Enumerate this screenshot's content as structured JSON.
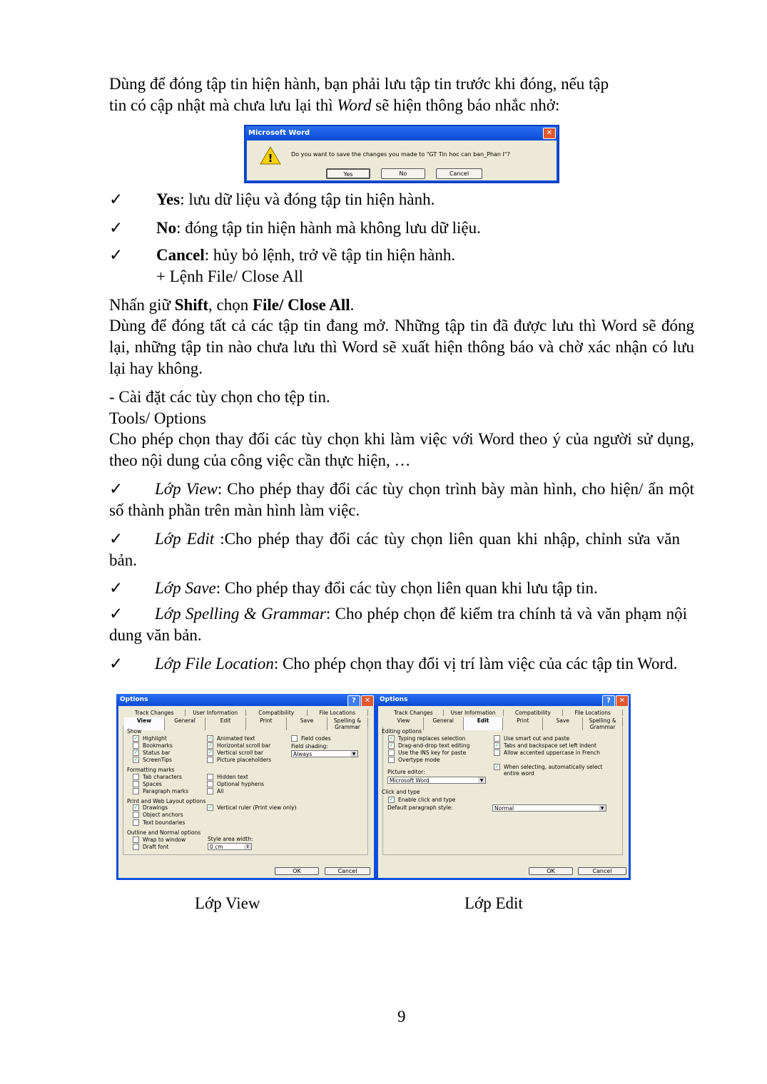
{
  "intro": {
    "line1": "Dùng để đóng tập tin hiện hành, bạn phải lưu tập tin trước khi đóng, nếu tập",
    "line2a": "tin có cập nhật mà chưa lưu lại thì ",
    "line2b": "Word",
    "line2c": " sẽ hiện thông báo nhắc nhở:"
  },
  "msgbox": {
    "title": "Microsoft Word",
    "icon": "warning-icon",
    "message": "Do you want to save the changes you made to \"GT Tin hoc can ban_Phan I\"?",
    "yes": "Yes",
    "no": "No",
    "cancel": "Cancel"
  },
  "check_glyph": "✓",
  "bullets": [
    {
      "bold": "Yes",
      "text": ": lưu dữ liệu và đóng tập tin hiện hành."
    },
    {
      "bold": "No",
      "text": ": đóng tập tin hiện hành mà không lưu dữ liệu."
    },
    {
      "bold": "Cancel",
      "text": ": hủy bỏ lệnh, trở về tập tin hiện hành."
    }
  ],
  "close_all": {
    "heading": "+ Lệnh File/ Close All",
    "p1a": "Nhấn giữ ",
    "p1b": "Shift",
    "p1c": ", chọn ",
    "p1d": "File/ Close All",
    "p1e": ".",
    "p2": "Dùng để đóng tất cả các tập tin đang mở. Những tập tin đã được lưu thì Word sẽ đóng lại, những tập tin nào chưa lưu thì Word sẽ xuất hiện thông báo và chờ xác nhận có lưu lại hay không."
  },
  "options": {
    "heading": "- Cài đặt các tùy chọn cho tệp tin.",
    "menu": "Tools/ Options",
    "desc": "Cho phép chọn thay đổi các tùy chọn khi làm việc với Word theo ý của người sử dụng, theo nội dung của công việc cần thực hiện, …"
  },
  "tabs_list": [
    {
      "name": "Lớp View",
      "text": ": Cho phép thay đổi các tùy chọn trình bày màn hình, cho hiện/ ẩn một số thành phần trên màn hình làm việc."
    },
    {
      "name": "Lớp Edit",
      "text": " :Cho phép thay đổi các tùy chọn liên quan khi nhập, chỉnh sửa văn bản."
    },
    {
      "name": "Lớp Save",
      "text": ": Cho phép thay đổi các tùy chọn liên quan khi lưu tập tin."
    },
    {
      "name": "Lớp Spelling & Grammar",
      "text": ": Cho phép chọn để kiểm tra chính tả và văn phạm nội dung văn bản."
    },
    {
      "name": "Lớp File Location",
      "text": ": Cho phép chọn thay đổi vị trí làm việc của các tập tin Word."
    }
  ],
  "dialog_common": {
    "tabs_row1": [
      "Track Changes",
      "User Information",
      "Compatibility",
      "File Locations"
    ],
    "tabs_row2": [
      "View",
      "General",
      "Edit",
      "Print",
      "Save",
      "Spelling & Grammar"
    ],
    "ok": "OK",
    "cancel": "Cancel",
    "help": "?",
    "close": "✕"
  },
  "view_dialog": {
    "title": "Options",
    "active_tab": "View",
    "sections": [
      "Show",
      "Formatting marks",
      "Print and Web Layout options",
      "Outline and Normal options"
    ],
    "checkboxes": [
      {
        "label": "Highlight",
        "checked": true
      },
      {
        "label": "Bookmarks",
        "checked": false
      },
      {
        "label": "Status bar",
        "checked": true
      },
      {
        "label": "ScreenTips",
        "checked": true
      },
      {
        "label": "Animated text",
        "checked": true
      },
      {
        "label": "Horizontal scroll bar",
        "checked": true
      },
      {
        "label": "Vertical scroll bar",
        "checked": true
      },
      {
        "label": "Picture placeholders",
        "checked": false
      },
      {
        "label": "Field codes",
        "checked": false
      },
      {
        "label": "Tab characters",
        "checked": false
      },
      {
        "label": "Spaces",
        "checked": false
      },
      {
        "label": "Paragraph marks",
        "checked": false
      },
      {
        "label": "Hidden text",
        "checked": false
      },
      {
        "label": "Optional hyphens",
        "checked": false
      },
      {
        "label": "All",
        "checked": false
      },
      {
        "label": "Drawings",
        "checked": true
      },
      {
        "label": "Object anchors",
        "checked": false
      },
      {
        "label": "Text boundaries",
        "checked": false
      },
      {
        "label": "Vertical ruler (Print view only)",
        "checked": true
      },
      {
        "label": "Wrap to window",
        "checked": false
      },
      {
        "label": "Draft font",
        "checked": false
      }
    ],
    "field_shading_label": "Field shading:",
    "field_shading_value": "Always",
    "style_area_label": "Style area width:",
    "style_area_value": "0 cm"
  },
  "edit_dialog": {
    "title": "Options",
    "active_tab": "Edit",
    "sections": [
      "Editing options",
      "Click and type"
    ],
    "checkboxes": [
      {
        "label": "Typing replaces selection",
        "checked": true
      },
      {
        "label": "Drag-and-drop text editing",
        "checked": true
      },
      {
        "label": "Use the INS key for paste",
        "checked": false
      },
      {
        "label": "Overtype mode",
        "checked": false
      },
      {
        "label": "Use smart cut and paste",
        "checked": false
      },
      {
        "label": "Tabs and backspace set left indent",
        "checked": true
      },
      {
        "label": "Allow accented uppercase in French",
        "checked": false
      },
      {
        "label": "When selecting, automatically select entire word",
        "checked": true
      },
      {
        "label": "Enable click and type",
        "checked": true
      }
    ],
    "picture_editor_label": "Picture editor:",
    "picture_editor_value": "Microsoft Word",
    "default_style_label": "Default paragraph style:",
    "default_style_value": "Normal"
  },
  "captions": {
    "left": "Lớp View",
    "right": "Lớp Edit"
  },
  "page_number": "9"
}
